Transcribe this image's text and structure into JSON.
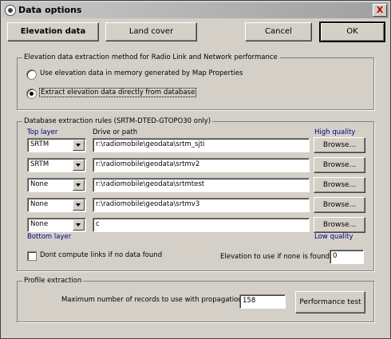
{
  "window": {
    "title": "Data options",
    "close_label": "X"
  },
  "top_buttons": {
    "elevation": "Elevation data",
    "land_cover": "Land cover",
    "cancel": "Cancel",
    "ok": "OK"
  },
  "method_group": {
    "label": "Elevation data extraction method for Radio Link and Network performance",
    "option_memory": "Use elevation data in memory generated by Map Properties",
    "option_database": "Extract elevation data directly from database",
    "selected": "database"
  },
  "rules_group": {
    "label": "Database extraction rules (SRTM-DTED-GTOPO30 only)",
    "top_layer": "Top layer",
    "drive_path": "Drive or path",
    "high_quality": "High quality",
    "bottom_layer": "Bottom layer",
    "low_quality": "Low quality",
    "browse": "Browse...",
    "rows": [
      {
        "layer": "SRTM",
        "path": "r:\\radiomobile\\geodata\\srtm_sjti"
      },
      {
        "layer": "SRTM",
        "path": "r:\\radiomobile\\geodata\\srtmv2"
      },
      {
        "layer": "None",
        "path": "r:\\radiomobile\\geodata\\srtmtest"
      },
      {
        "layer": "None",
        "path": "r:\\radiomobile\\geodata\\srtmv3"
      },
      {
        "layer": "None",
        "path": "c"
      }
    ],
    "dont_compute": "Dont compute links if no data found",
    "elevation_none_label": "Elevation to use if none is found (m)",
    "elevation_none_value": "0"
  },
  "profile_group": {
    "label": "Profile extraction",
    "max_records_label": "Maximum number of records to use with propagation model",
    "max_records_value": "158",
    "performance_test": "Performance test"
  }
}
